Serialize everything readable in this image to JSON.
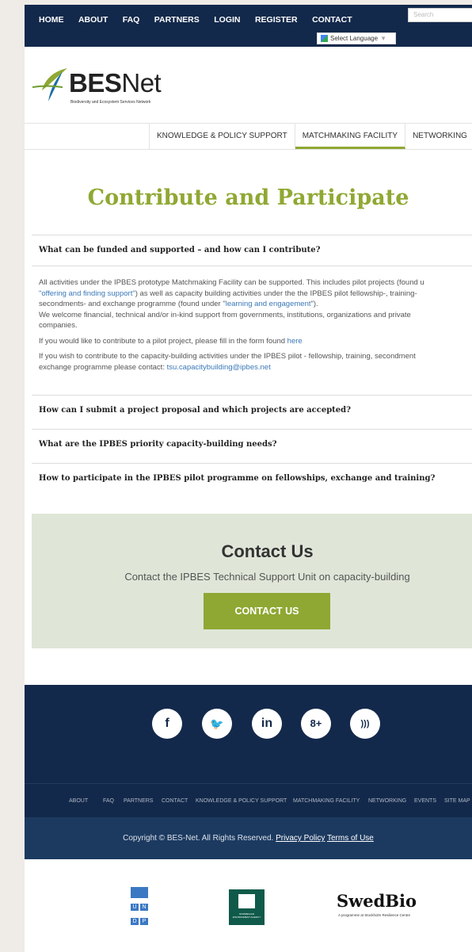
{
  "topnav": {
    "links": [
      "HOME",
      "ABOUT",
      "FAQ",
      "PARTNERS",
      "LOGIN",
      "REGISTER",
      "CONTACT"
    ],
    "search_placeholder": "Search",
    "language_label": "Select Language",
    "language_arrow": "▼"
  },
  "logo": {
    "name_bold": "BES",
    "name_regular": "Net",
    "tagline": "Biodiversity and Ecosystem Services Network"
  },
  "mainnav": {
    "items": [
      "KNOWLEDGE & POLICY SUPPORT",
      "MATCHMAKING FACILITY",
      "NETWORKING",
      "E"
    ],
    "active": "MATCHMAKING FACILITY"
  },
  "page_title": "Contribute and Participate",
  "faq": {
    "q1": "What can be funded and supported – and how can I contribute?",
    "p1_a": "All activities under the IPBES prototype Matchmaking Facility can be supported. This includes pilot projects (found u",
    "p1_link1": "\"offering and finding support\"",
    "p1_b": ") as well as capacity building activities under the the IPBES pilot fellowship-, training-",
    "p1_c": "secondments- and exchange programme (found under \"",
    "p1_link2": "learning and engagement",
    "p1_d": "\").",
    "p1_e": "We welcome financial, technical and/or in-kind support from governments, institutions, organizations and private",
    "p1_f": "companies.",
    "p2": "If you would like to contribute to a pilot project, please fill in the form found ",
    "p2_link": "here",
    "p3_a": "If you wish to contribute to the capacity-building activities under the IPBES pilot - fellowship, training, secondment",
    "p3_b": "exchange programme please contact: ",
    "p3_email": "tsu.capacitybuilding@ipbes.net",
    "q2": "How can I submit a project proposal and which projects are accepted?",
    "q3": "What are the IPBES priority capacity-building needs?",
    "q4": "How to participate in the IPBES pilot programme on fellowships, exchange and training?"
  },
  "contact": {
    "heading": "Contact Us",
    "subtext": "Contact the IPBES Technical Support Unit on capacity-building",
    "button": "CONTACT US"
  },
  "social": {
    "facebook": "f",
    "twitter": "🐦",
    "linkedin": "in",
    "googleplus": "8+",
    "rss": ")))"
  },
  "footer_links": [
    "ABOUT",
    "FAQ",
    "PARTNERS",
    "CONTACT",
    "KNOWLEDGE & POLICY SUPPORT",
    "MATCHMAKING FACILITY",
    "NETWORKING",
    "EVENTS",
    "SITE MAP"
  ],
  "copyright": {
    "text": "Copyright © BES-Net. All Rights Reserved. ",
    "privacy": "Privacy Policy",
    "terms": "Terms of Use"
  },
  "partners": {
    "undp_letters": [
      "U",
      "N",
      "D",
      "P"
    ],
    "neag_text": "NORWEGIAN ENVIRONMENT AGENCY",
    "swedbio": "SwedBio",
    "swedbio_tag": "A programme at Stockholm Resilience Centre"
  },
  "colors": {
    "navy": "#13294b",
    "green": "#8fa833",
    "link": "#3a78b8",
    "contact_bg": "#dfe6d8"
  }
}
